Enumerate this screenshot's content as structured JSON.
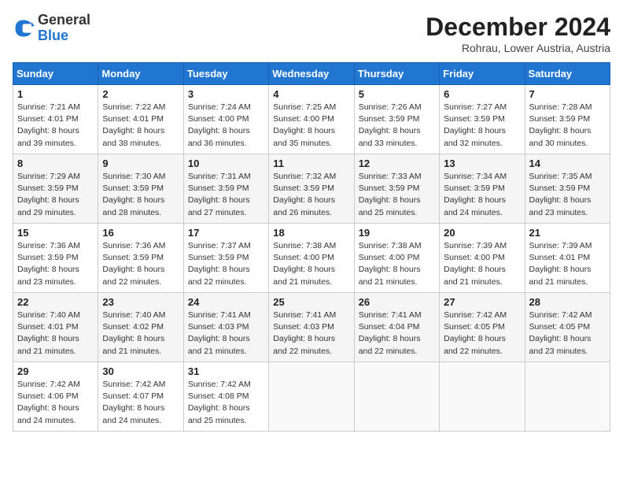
{
  "header": {
    "logo_line1": "General",
    "logo_line2": "Blue",
    "month": "December 2024",
    "location": "Rohrau, Lower Austria, Austria"
  },
  "weekdays": [
    "Sunday",
    "Monday",
    "Tuesday",
    "Wednesday",
    "Thursday",
    "Friday",
    "Saturday"
  ],
  "weeks": [
    [
      {
        "day": "1",
        "sunrise": "7:21 AM",
        "sunset": "4:01 PM",
        "daylight": "8 hours and 39 minutes."
      },
      {
        "day": "2",
        "sunrise": "7:22 AM",
        "sunset": "4:01 PM",
        "daylight": "8 hours and 38 minutes."
      },
      {
        "day": "3",
        "sunrise": "7:24 AM",
        "sunset": "4:00 PM",
        "daylight": "8 hours and 36 minutes."
      },
      {
        "day": "4",
        "sunrise": "7:25 AM",
        "sunset": "4:00 PM",
        "daylight": "8 hours and 35 minutes."
      },
      {
        "day": "5",
        "sunrise": "7:26 AM",
        "sunset": "3:59 PM",
        "daylight": "8 hours and 33 minutes."
      },
      {
        "day": "6",
        "sunrise": "7:27 AM",
        "sunset": "3:59 PM",
        "daylight": "8 hours and 32 minutes."
      },
      {
        "day": "7",
        "sunrise": "7:28 AM",
        "sunset": "3:59 PM",
        "daylight": "8 hours and 30 minutes."
      }
    ],
    [
      {
        "day": "8",
        "sunrise": "7:29 AM",
        "sunset": "3:59 PM",
        "daylight": "8 hours and 29 minutes."
      },
      {
        "day": "9",
        "sunrise": "7:30 AM",
        "sunset": "3:59 PM",
        "daylight": "8 hours and 28 minutes."
      },
      {
        "day": "10",
        "sunrise": "7:31 AM",
        "sunset": "3:59 PM",
        "daylight": "8 hours and 27 minutes."
      },
      {
        "day": "11",
        "sunrise": "7:32 AM",
        "sunset": "3:59 PM",
        "daylight": "8 hours and 26 minutes."
      },
      {
        "day": "12",
        "sunrise": "7:33 AM",
        "sunset": "3:59 PM",
        "daylight": "8 hours and 25 minutes."
      },
      {
        "day": "13",
        "sunrise": "7:34 AM",
        "sunset": "3:59 PM",
        "daylight": "8 hours and 24 minutes."
      },
      {
        "day": "14",
        "sunrise": "7:35 AM",
        "sunset": "3:59 PM",
        "daylight": "8 hours and 23 minutes."
      }
    ],
    [
      {
        "day": "15",
        "sunrise": "7:36 AM",
        "sunset": "3:59 PM",
        "daylight": "8 hours and 23 minutes."
      },
      {
        "day": "16",
        "sunrise": "7:36 AM",
        "sunset": "3:59 PM",
        "daylight": "8 hours and 22 minutes."
      },
      {
        "day": "17",
        "sunrise": "7:37 AM",
        "sunset": "3:59 PM",
        "daylight": "8 hours and 22 minutes."
      },
      {
        "day": "18",
        "sunrise": "7:38 AM",
        "sunset": "4:00 PM",
        "daylight": "8 hours and 21 minutes."
      },
      {
        "day": "19",
        "sunrise": "7:38 AM",
        "sunset": "4:00 PM",
        "daylight": "8 hours and 21 minutes."
      },
      {
        "day": "20",
        "sunrise": "7:39 AM",
        "sunset": "4:00 PM",
        "daylight": "8 hours and 21 minutes."
      },
      {
        "day": "21",
        "sunrise": "7:39 AM",
        "sunset": "4:01 PM",
        "daylight": "8 hours and 21 minutes."
      }
    ],
    [
      {
        "day": "22",
        "sunrise": "7:40 AM",
        "sunset": "4:01 PM",
        "daylight": "8 hours and 21 minutes."
      },
      {
        "day": "23",
        "sunrise": "7:40 AM",
        "sunset": "4:02 PM",
        "daylight": "8 hours and 21 minutes."
      },
      {
        "day": "24",
        "sunrise": "7:41 AM",
        "sunset": "4:03 PM",
        "daylight": "8 hours and 21 minutes."
      },
      {
        "day": "25",
        "sunrise": "7:41 AM",
        "sunset": "4:03 PM",
        "daylight": "8 hours and 22 minutes."
      },
      {
        "day": "26",
        "sunrise": "7:41 AM",
        "sunset": "4:04 PM",
        "daylight": "8 hours and 22 minutes."
      },
      {
        "day": "27",
        "sunrise": "7:42 AM",
        "sunset": "4:05 PM",
        "daylight": "8 hours and 22 minutes."
      },
      {
        "day": "28",
        "sunrise": "7:42 AM",
        "sunset": "4:05 PM",
        "daylight": "8 hours and 23 minutes."
      }
    ],
    [
      {
        "day": "29",
        "sunrise": "7:42 AM",
        "sunset": "4:06 PM",
        "daylight": "8 hours and 24 minutes."
      },
      {
        "day": "30",
        "sunrise": "7:42 AM",
        "sunset": "4:07 PM",
        "daylight": "8 hours and 24 minutes."
      },
      {
        "day": "31",
        "sunrise": "7:42 AM",
        "sunset": "4:08 PM",
        "daylight": "8 hours and 25 minutes."
      },
      null,
      null,
      null,
      null
    ]
  ]
}
